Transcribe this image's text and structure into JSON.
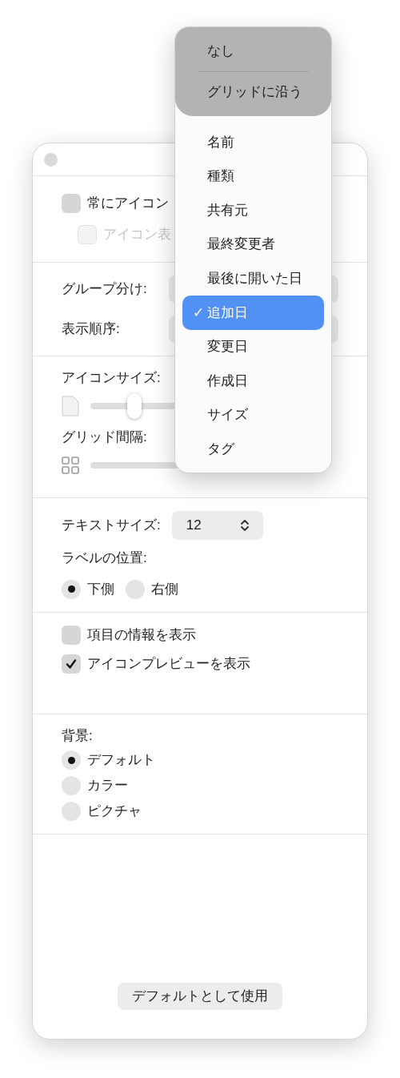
{
  "window": {
    "options": [
      {
        "label": "常にアイコン",
        "checked": false,
        "disabled": false
      },
      {
        "label": "アイコン表",
        "checked": false,
        "disabled": true
      }
    ],
    "grouping": {
      "label": "グループ分け:"
    },
    "sort": {
      "label": "表示順序:"
    },
    "icon_size": {
      "label": "アイコンサイズ:",
      "level": 0.19
    },
    "grid_spacing": {
      "label": "グリッド間隔:"
    },
    "text_size": {
      "label": "テキストサイズ:",
      "value": "12"
    },
    "label_position": {
      "label": "ラベルの位置:",
      "options": [
        {
          "label": "下側",
          "selected": true
        },
        {
          "label": "右側",
          "selected": false
        }
      ]
    },
    "display_options": [
      {
        "label": "項目の情報を表示",
        "checked": false
      },
      {
        "label": "アイコンプレビューを表示",
        "checked": true
      }
    ],
    "background": {
      "label": "背景:",
      "options": [
        {
          "label": "デフォルト",
          "selected": true
        },
        {
          "label": "カラー",
          "selected": false
        },
        {
          "label": "ピクチャ",
          "selected": false
        }
      ]
    },
    "default_button": "デフォルトとして使用"
  },
  "menu": {
    "top_items": [
      {
        "label": "なし"
      },
      {
        "label": "グリッドに沿う"
      }
    ],
    "items": [
      {
        "label": "名前",
        "selected": false
      },
      {
        "label": "種類",
        "selected": false
      },
      {
        "label": "共有元",
        "selected": false
      },
      {
        "label": "最終変更者",
        "selected": false
      },
      {
        "label": "最後に開いた日",
        "selected": false
      },
      {
        "label": "追加日",
        "selected": true
      },
      {
        "label": "変更日",
        "selected": false
      },
      {
        "label": "作成日",
        "selected": false
      },
      {
        "label": "サイズ",
        "selected": false
      },
      {
        "label": "タグ",
        "selected": false
      }
    ],
    "check_mark": "✓"
  }
}
